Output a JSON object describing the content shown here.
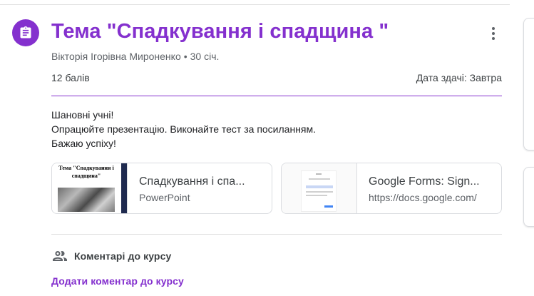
{
  "assignment": {
    "icon": "assignment-icon",
    "title": "Тема \"Спадкування і спадщина \"",
    "author": "Вікторія Ігорівна Мироненко",
    "date": "30 січ.",
    "points": "12 балів",
    "due_label": "Дата здачі:",
    "due_value": "Завтра",
    "more_icon": "more-vert-icon",
    "accent_color": "#8430ce"
  },
  "instructions": [
    "Шановні учні!",
    "Опрацюйте презентацію. Виконайте тест за посиланням.",
    "Бажаю успіху!"
  ],
  "attachments": [
    {
      "title": "Спадкування і спа...",
      "subtitle": "PowerPoint",
      "thumb_text": "Тема \"Спадкування і спадщина\""
    },
    {
      "title": "Google Forms: Sign...",
      "subtitle": "https://docs.google.com/"
    }
  ],
  "comments": {
    "icon": "people-icon",
    "label": "Коментарі до курсу",
    "add_label": "Додати коментар до курсу"
  }
}
